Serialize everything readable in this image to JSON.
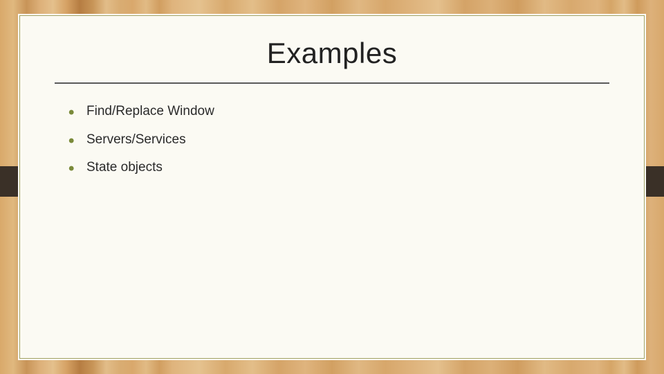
{
  "slide": {
    "title": "Examples",
    "bullets": [
      "Find/Replace Window",
      "Servers/Services",
      "State objects"
    ]
  }
}
